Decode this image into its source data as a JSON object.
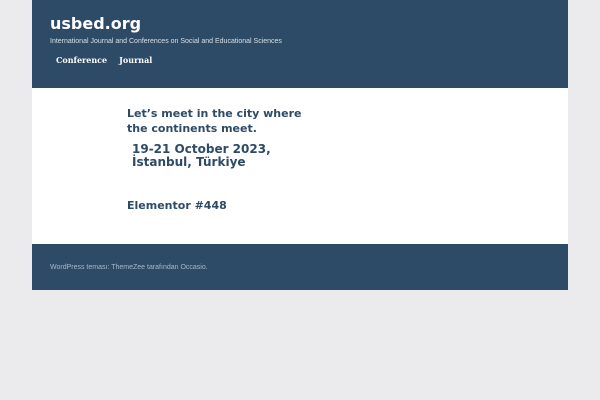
{
  "header": {
    "site_title": "usbed.org",
    "site_description": "International Journal and Conferences on Social and Educational Sciences",
    "nav": [
      {
        "label": "Conference"
      },
      {
        "label": "Journal"
      }
    ]
  },
  "content": {
    "tagline_line1": "Let’s meet in the city where",
    "tagline_line2": "the continents meet.",
    "event_date": "19-21 October 2023,",
    "event_location": "İstanbul, Türkiye",
    "elementor_heading": "Elementor #448"
  },
  "footer": {
    "credit": "WordPress teması: ThemeZee tarafından Occasio."
  },
  "colors": {
    "header_bg": "#2d4a66",
    "content_bg": "#ffffff",
    "page_bg": "#ebebed",
    "heading_text": "#2d4a66"
  }
}
